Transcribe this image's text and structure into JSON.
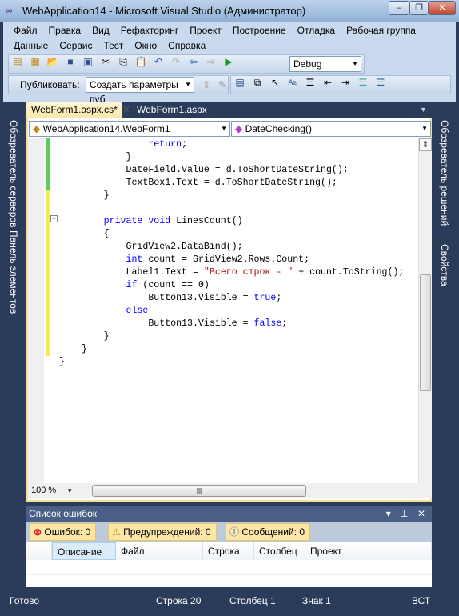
{
  "window": {
    "title": "WebApplication14 - Microsoft Visual Studio (Администратор)",
    "minimize": "‒",
    "restore": "❐",
    "close": "✕"
  },
  "menu": {
    "row1": [
      "Файл",
      "Правка",
      "Вид",
      "Рефакторинг",
      "Проект",
      "Построение",
      "Отладка",
      "Рабочая группа"
    ],
    "row2": [
      "Данные",
      "Сервис",
      "Тест",
      "Окно",
      "Справка"
    ]
  },
  "toolbar": {
    "config": "Debug",
    "publish_label": "Публиковать:",
    "publish_value": "Создать параметры пуб"
  },
  "tabs": [
    {
      "label": "WebForm1.aspx.cs*",
      "active": true
    },
    {
      "label": "WebForm1.aspx",
      "active": false
    }
  ],
  "nav": {
    "class": "WebApplication14.WebForm1",
    "member": "DateChecking()"
  },
  "side": {
    "left1": "Обозреватель серверов",
    "left2": "Панель элементов",
    "right1": "Обозреватель решений",
    "right2": "Свойства"
  },
  "code": [
    [
      [
        "                "
      ],
      [
        "return",
        "kw"
      ],
      [
        ";"
      ]
    ],
    [
      [
        "            }"
      ]
    ],
    [
      [
        "            DateField.Value = d.ToShortDateString();"
      ]
    ],
    [
      [
        "            TextBox1.Text = d.ToShortDateString();"
      ]
    ],
    [
      [
        "        }"
      ]
    ],
    [
      [
        ""
      ]
    ],
    [
      [
        "        "
      ],
      [
        "private",
        "kw"
      ],
      [
        " "
      ],
      [
        "void",
        "kw"
      ],
      [
        " LinesCount()"
      ]
    ],
    [
      [
        "        {"
      ]
    ],
    [
      [
        "            GridView2.DataBind();"
      ]
    ],
    [
      [
        "            "
      ],
      [
        "int",
        "kw"
      ],
      [
        " count = GridView2.Rows.Count;"
      ]
    ],
    [
      [
        "            Label1.Text = "
      ],
      [
        "\"Всего строк - \"",
        "str"
      ],
      [
        " + count.ToString();"
      ]
    ],
    [
      [
        "            "
      ],
      [
        "if",
        "kw"
      ],
      [
        " (count == 0)"
      ]
    ],
    [
      [
        "                Button13.Visible = "
      ],
      [
        "true",
        "kw"
      ],
      [
        ";"
      ]
    ],
    [
      [
        "            "
      ],
      [
        "else",
        "kw"
      ]
    ],
    [
      [
        "                Button13.Visible = "
      ],
      [
        "false",
        "kw"
      ],
      [
        ";"
      ]
    ],
    [
      [
        "        }"
      ]
    ],
    [
      [
        "    }"
      ]
    ],
    [
      [
        "}"
      ]
    ]
  ],
  "zoom": "100 %",
  "errors": {
    "title": "Список ошибок",
    "errors": "Ошибок: 0",
    "warnings": "Предупреждений: 0",
    "messages": "Сообщений: 0",
    "columns": [
      "Описание",
      "Файл",
      "Строка",
      "Столбец",
      "Проект"
    ]
  },
  "status": {
    "ready": "Готово",
    "line": "Строка 20",
    "col": "Столбец 1",
    "ch": "Знак 1",
    "mode": "ВСТ"
  }
}
